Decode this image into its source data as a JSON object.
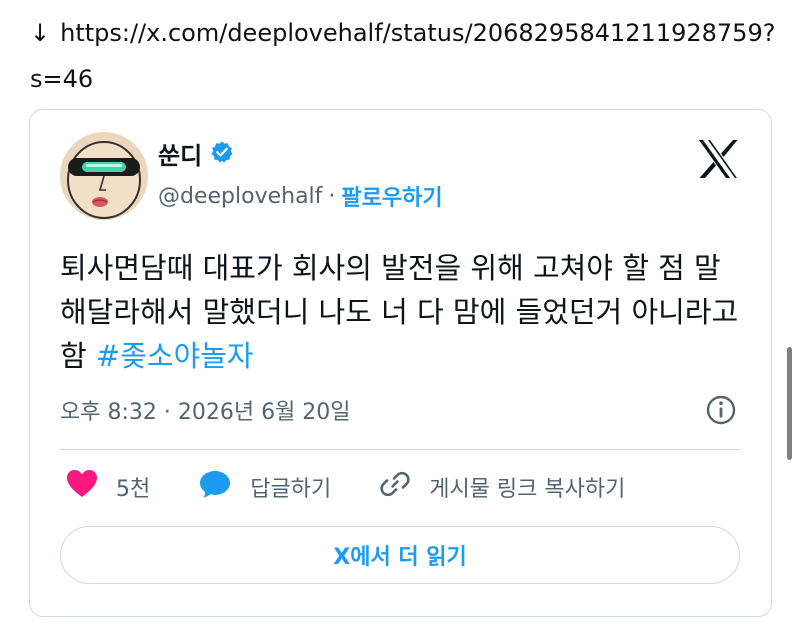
{
  "url_bar": {
    "arrow": "↓",
    "url": "https://x.com/deeplovehalf/status/2068295841211928759?s=46"
  },
  "tweet": {
    "display_name": "쑨디",
    "handle": "@deeplovehalf",
    "separator": "·",
    "follow_label": "팔로우하기",
    "text": "퇴사면담때 대표가 회사의 발전을 위해 고쳐야 할 점 말해달라해서 말했더니 나도 너 다 맘에 들었던거 아니라고함",
    "hashtag": "#좆소야놀자",
    "timestamp": "오후 8:32 · 2026년 6월 20일",
    "actions": {
      "like_count": "5천",
      "reply_label": "답글하기",
      "copy_link_label": "게시물 링크 복사하기"
    },
    "read_more_label": "X에서 더 읽기"
  },
  "colors": {
    "accent": "#1d9bf0",
    "like": "#f91880",
    "muted": "#536471",
    "border": "#cfd9de"
  },
  "icons": [
    "verified-badge-icon",
    "x-logo-icon",
    "info-icon",
    "heart-icon",
    "reply-bubble-icon",
    "link-icon"
  ]
}
